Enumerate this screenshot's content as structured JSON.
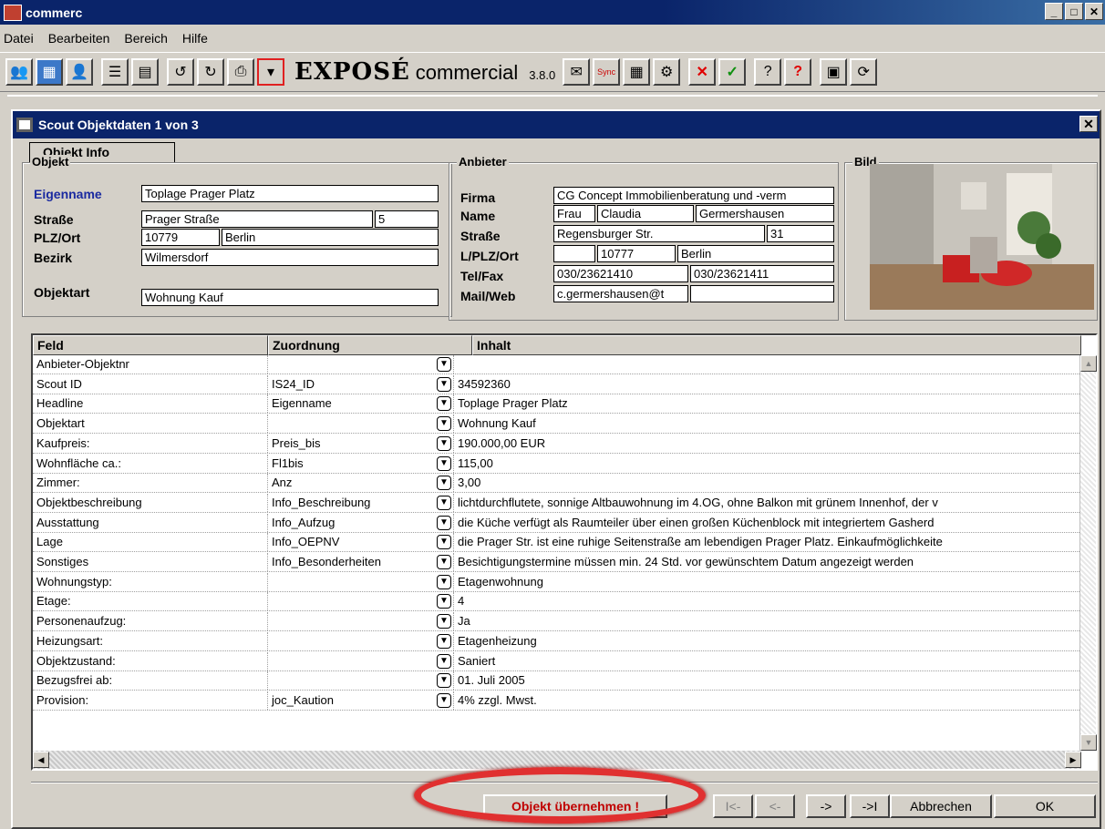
{
  "app": {
    "title": "commerc",
    "menu": [
      "Datei",
      "Bearbeiten",
      "Bereich",
      "Hilfe"
    ],
    "brand_expose": "EXPOSÉ",
    "brand_commercial": "commercial",
    "version": "3.8.0",
    "toolbar_sync_label": "Sync"
  },
  "dialog": {
    "title": "Scout Objektdaten 1 von 3",
    "tab_label": "Objekt Info",
    "objekt": {
      "legend": "Objekt",
      "eigenname_label": "Eigenname",
      "eigenname": "Toplage Prager Platz",
      "strasse_label": "Straße",
      "strasse": "Prager Straße",
      "hausnr": "5",
      "plz_label": "PLZ/Ort",
      "plz": "10779",
      "ort": "Berlin",
      "bezirk_label": "Bezirk",
      "bezirk": "Wilmersdorf",
      "objektart_label": "Objektart",
      "objektart": "Wohnung Kauf"
    },
    "anbieter": {
      "legend": "Anbieter",
      "firma_label": "Firma",
      "firma": "CG Concept Immobilienberatung und -verm",
      "name_label": "Name",
      "anrede": "Frau",
      "vorname": "Claudia",
      "nachname": "Germershausen",
      "strasse_label": "Straße",
      "strasse": "Regensburger Str.",
      "hausnr": "31",
      "lplz_label": "L/PLZ/Ort",
      "land": "",
      "plz": "10777",
      "ort": "Berlin",
      "telfax_label": "Tel/Fax",
      "tel": "030/23621410",
      "fax": "030/23621411",
      "mailweb_label": "Mail/Web",
      "mail": "c.germershausen@t",
      "web": ""
    },
    "bild_legend": "Bild",
    "grid": {
      "headers": [
        "Feld",
        "Zuordnung",
        "Inhalt"
      ],
      "rows": [
        {
          "feld": "Anbieter-Objektnr",
          "zuordnung": "",
          "inhalt": ""
        },
        {
          "feld": "Scout ID",
          "zuordnung": "IS24_ID",
          "inhalt": "34592360"
        },
        {
          "feld": "Headline",
          "zuordnung": "Eigenname",
          "inhalt": "Toplage Prager Platz"
        },
        {
          "feld": "Objektart",
          "zuordnung": "",
          "inhalt": "Wohnung Kauf"
        },
        {
          "feld": "Kaufpreis:",
          "zuordnung": "Preis_bis",
          "inhalt": "190.000,00 EUR"
        },
        {
          "feld": "Wohnfläche ca.:",
          "zuordnung": "Fl1bis",
          "inhalt": "115,00"
        },
        {
          "feld": "Zimmer:",
          "zuordnung": "Anz",
          "inhalt": "3,00"
        },
        {
          "feld": "Objektbeschreibung",
          "zuordnung": "Info_Beschreibung",
          "inhalt": "lichtdurchflutete, sonnige Altbauwohnung im 4.OG, ohne Balkon mit grünem Innenhof, der v"
        },
        {
          "feld": "Ausstattung",
          "zuordnung": "Info_Aufzug",
          "inhalt": "die Küche verfügt als Raumteiler über einen großen Küchenblock mit integriertem Gasherd"
        },
        {
          "feld": "Lage",
          "zuordnung": "Info_OEPNV",
          "inhalt": "die Prager Str. ist eine ruhige Seitenstraße am lebendigen Prager Platz. Einkaufmöglichkeite"
        },
        {
          "feld": "Sonstiges",
          "zuordnung": "Info_Besonderheiten",
          "inhalt": "Besichtigungstermine müssen min. 24 Std. vor gewünschtem Datum angezeigt werden"
        },
        {
          "feld": "Wohnungstyp:",
          "zuordnung": "",
          "inhalt": "Etagenwohnung"
        },
        {
          "feld": "Etage:",
          "zuordnung": "",
          "inhalt": "4"
        },
        {
          "feld": "Personenaufzug:",
          "zuordnung": "",
          "inhalt": "Ja"
        },
        {
          "feld": "Heizungsart:",
          "zuordnung": "",
          "inhalt": "Etagenheizung"
        },
        {
          "feld": "Objektzustand:",
          "zuordnung": "",
          "inhalt": "Saniert"
        },
        {
          "feld": "Bezugsfrei ab:",
          "zuordnung": "",
          "inhalt": "01. Juli 2005"
        },
        {
          "feld": "Provision:",
          "zuordnung": "joc_Kaution",
          "inhalt": "4% zzgl. Mwst."
        }
      ]
    },
    "buttons": {
      "take": "Objekt übernehmen !",
      "first": "I<-",
      "prev": "<-",
      "next": "->",
      "last": "->I",
      "cancel": "Abbrechen",
      "ok": "OK"
    }
  }
}
